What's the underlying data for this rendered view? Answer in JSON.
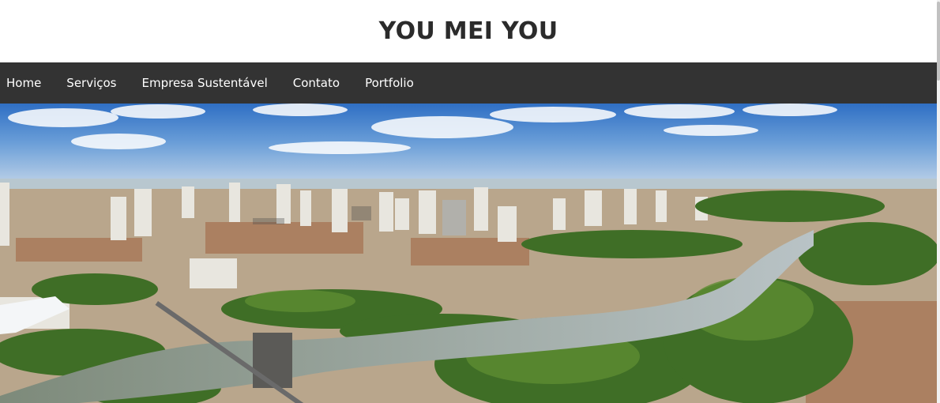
{
  "header": {
    "title": "YOU MEI YOU"
  },
  "nav": {
    "items": [
      {
        "label": "Home"
      },
      {
        "label": "Serviços"
      },
      {
        "label": "Empresa Sustentável"
      },
      {
        "label": "Contato"
      },
      {
        "label": "Portfolio"
      }
    ]
  },
  "colors": {
    "navbar": "#333333",
    "nav_text": "#ffffff",
    "title": "#2b2b2b"
  }
}
